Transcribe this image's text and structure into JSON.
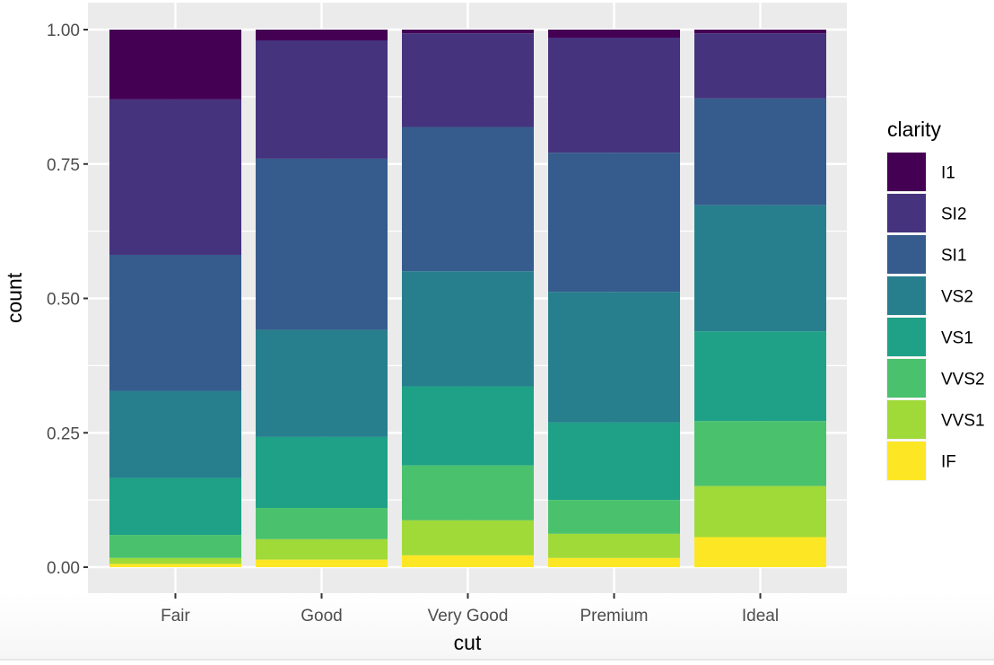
{
  "chart_data": {
    "type": "bar",
    "subtype": "stacked-proportion",
    "title": "",
    "xlabel": "cut",
    "ylabel": "count",
    "ylim": [
      0,
      1
    ],
    "y_ticks": [
      0,
      0.25,
      0.5,
      0.75,
      1
    ],
    "y_tick_labels": [
      "0.00",
      "0.25",
      "0.50",
      "0.75",
      "1.00"
    ],
    "grid": true,
    "categories": [
      "Fair",
      "Good",
      "Very Good",
      "Premium",
      "Ideal"
    ],
    "legend": {
      "title": "clarity",
      "position": "right"
    },
    "series": [
      {
        "name": "I1",
        "color": "#440154",
        "values": [
          0.13,
          0.02,
          0.007,
          0.015,
          0.007
        ]
      },
      {
        "name": "SI2",
        "color": "#46337E",
        "values": [
          0.289,
          0.22,
          0.174,
          0.214,
          0.121
        ]
      },
      {
        "name": "SI1",
        "color": "#365C8D",
        "values": [
          0.253,
          0.318,
          0.268,
          0.259,
          0.199
        ]
      },
      {
        "name": "VS2",
        "color": "#277F8E",
        "values": [
          0.162,
          0.199,
          0.214,
          0.243,
          0.235
        ]
      },
      {
        "name": "VS1",
        "color": "#1FA187",
        "values": [
          0.106,
          0.132,
          0.147,
          0.144,
          0.167
        ]
      },
      {
        "name": "VVS2",
        "color": "#4AC16D",
        "values": [
          0.043,
          0.058,
          0.102,
          0.063,
          0.121
        ]
      },
      {
        "name": "VVS1",
        "color": "#A0DA39",
        "values": [
          0.011,
          0.038,
          0.065,
          0.045,
          0.095
        ]
      },
      {
        "name": "IF",
        "color": "#FDE725",
        "values": [
          0.006,
          0.014,
          0.022,
          0.017,
          0.056
        ]
      }
    ],
    "stack_order_top_to_bottom": [
      "I1",
      "SI2",
      "SI1",
      "VS2",
      "VS1",
      "VVS2",
      "VVS1",
      "IF"
    ]
  }
}
